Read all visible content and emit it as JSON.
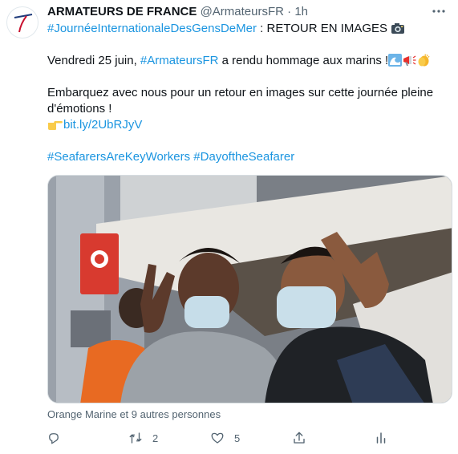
{
  "tweet": {
    "author_name": "ARMATEURS DE FRANCE",
    "handle": "@ArmateursFR",
    "separator": "·",
    "time": "1h",
    "hashtag_day": "#JournéeInternationaleDesGensDeMer",
    "headline": " : RETOUR EN IMAGES ",
    "para1_start": "Vendredi 25 juin, ",
    "mention": "#ArmateursFR",
    "para1_end": " a rendu hommage aux marins !",
    "para2_line1": "Embarquez avec nous pour un retour en images sur cette journée pleine",
    "para2_line2": "d'émotions !",
    "short_link": "bit.ly/2UbRJyV",
    "hashtag_1": "#SeafarersAreKeyWorkers",
    "hashtag_2": "#DayoftheSeafarer",
    "photo_tags": "Orange Marine et 9 autres personnes",
    "retweet_count": "2",
    "like_count": "5"
  },
  "icons": [
    "more-icon",
    "camera-emoji",
    "wave-emoji",
    "megaphone-emoji",
    "clap-emoji",
    "point-right-emoji",
    "reply-icon",
    "retweet-icon",
    "like-icon",
    "share-icon",
    "analytics-icon"
  ],
  "colors": {
    "link": "#1b95e0",
    "muted": "#536471",
    "text": "#0f1419"
  }
}
